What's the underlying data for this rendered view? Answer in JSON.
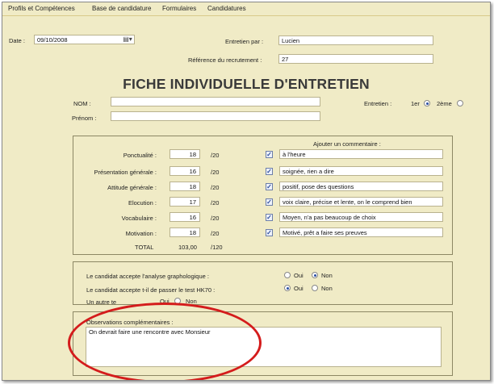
{
  "menu": [
    "Profils et Compétences",
    "Base de candidature",
    "Formulaires",
    "Candidatures"
  ],
  "header": {
    "date_label": "Date :",
    "date_value": "09/10/2008",
    "entretien_par_label": "Entretien par :",
    "entretien_par_value": "Lucien",
    "reference_label": "Référence du recrutement :",
    "reference_value": "27"
  },
  "title": "FICHE INDIVIDUELLE D'ENTRETIEN",
  "identity": {
    "nom_label": "NOM :",
    "nom_value": "",
    "prenom_label": "Prénom :",
    "prenom_value": "",
    "entretien_label": "Entretien :",
    "entretien_options": [
      "1er",
      "2ème"
    ],
    "entretien_selected": "1er"
  },
  "evaluation": {
    "comment_header": "Ajouter un commentaire :",
    "suffix": "/20",
    "rows": [
      {
        "label": "Ponctualité :",
        "score": "18",
        "checked": true,
        "comment": "à l'heure"
      },
      {
        "label": "Présentation générale :",
        "score": "16",
        "checked": true,
        "comment": "soignée, rien a dire"
      },
      {
        "label": "Attitude générale :",
        "score": "18",
        "checked": true,
        "comment": "positif, pose des questions"
      },
      {
        "label": "Elocution :",
        "score": "17",
        "checked": true,
        "comment": "voix claire, précise et lente, on le comprend bien"
      },
      {
        "label": "Vocabulaire :",
        "score": "16",
        "checked": true,
        "comment": "Moyen, n'a pas beaucoup de choix"
      },
      {
        "label": "Motivation :",
        "score": "18",
        "checked": true,
        "comment": "Motivé, prêt a faire ses preuves"
      }
    ],
    "total_label": "TOTAL",
    "total_value": "103,00",
    "total_suffix": "/120"
  },
  "tests": {
    "q1": "Le candidat accepte l'analyse graphologique :",
    "q1_selected": "Non",
    "q2": "Le candidat accepte t-il de passer le test HK70 :",
    "q2_selected": "Oui",
    "q3": "Un autre te",
    "q3_selected": "",
    "options": [
      "Oui",
      "Non"
    ]
  },
  "observations": {
    "label": "Observations complémentaires :",
    "value": "On devrait faire une rencontre avec Monsieur"
  },
  "annotation_color": "#d41c1c",
  "accent_color": "#2b4fa3"
}
